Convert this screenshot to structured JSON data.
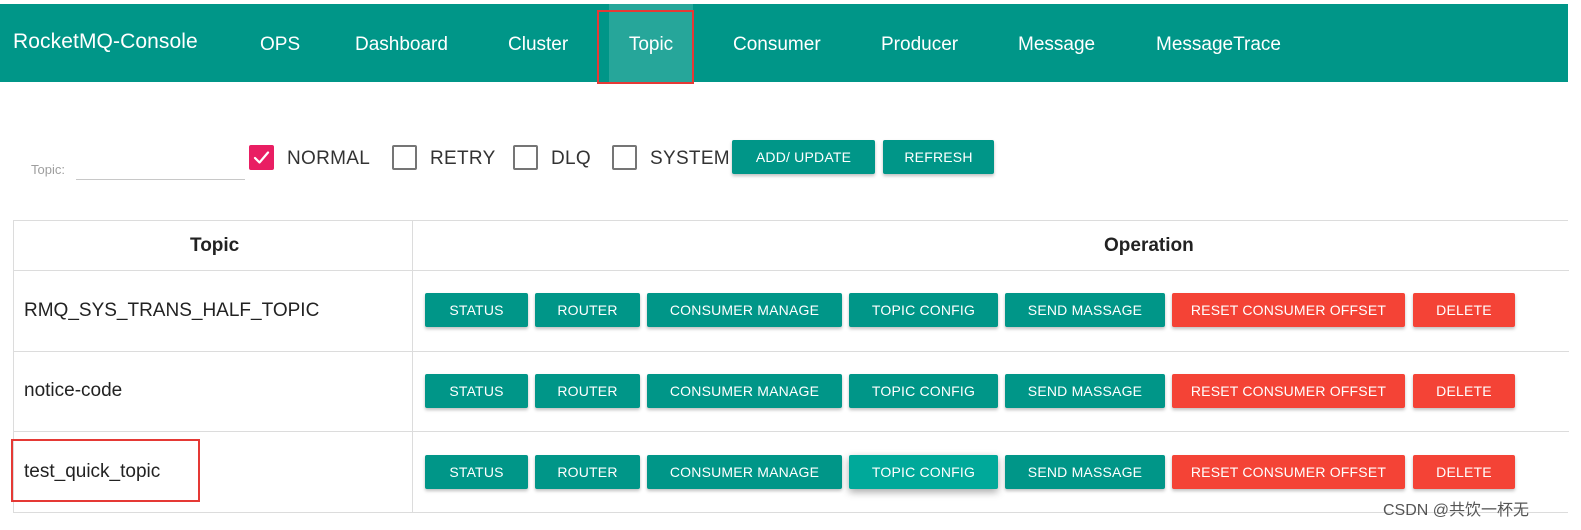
{
  "header": {
    "brand": "RocketMQ-Console",
    "nav": [
      "OPS",
      "Dashboard",
      "Cluster",
      "Topic",
      "Consumer",
      "Producer",
      "Message",
      "MessageTrace"
    ],
    "active": "Topic"
  },
  "filter": {
    "label": "Topic:",
    "value": "",
    "checkboxes": [
      {
        "label": "NORMAL",
        "checked": true
      },
      {
        "label": "RETRY",
        "checked": false
      },
      {
        "label": "DLQ",
        "checked": false
      },
      {
        "label": "SYSTEM",
        "checked": false
      }
    ],
    "add_update_label": "ADD/ UPDATE",
    "refresh_label": "REFRESH"
  },
  "table": {
    "columns": [
      "Topic",
      "Operation"
    ],
    "operations": [
      "STATUS",
      "ROUTER",
      "CONSUMER MANAGE",
      "TOPIC CONFIG",
      "SEND MASSAGE",
      "RESET CONSUMER OFFSET",
      "DELETE"
    ],
    "rows": [
      {
        "topic": "RMQ_SYS_TRANS_HALF_TOPIC"
      },
      {
        "topic": "notice-code"
      },
      {
        "topic": "test_quick_topic"
      }
    ]
  },
  "colors": {
    "primary": "#009688",
    "danger": "#f44336",
    "checkbox_checked": "#e91e63",
    "annotation_box": "#e53935"
  },
  "watermark": "CSDN @共饮一杯无"
}
